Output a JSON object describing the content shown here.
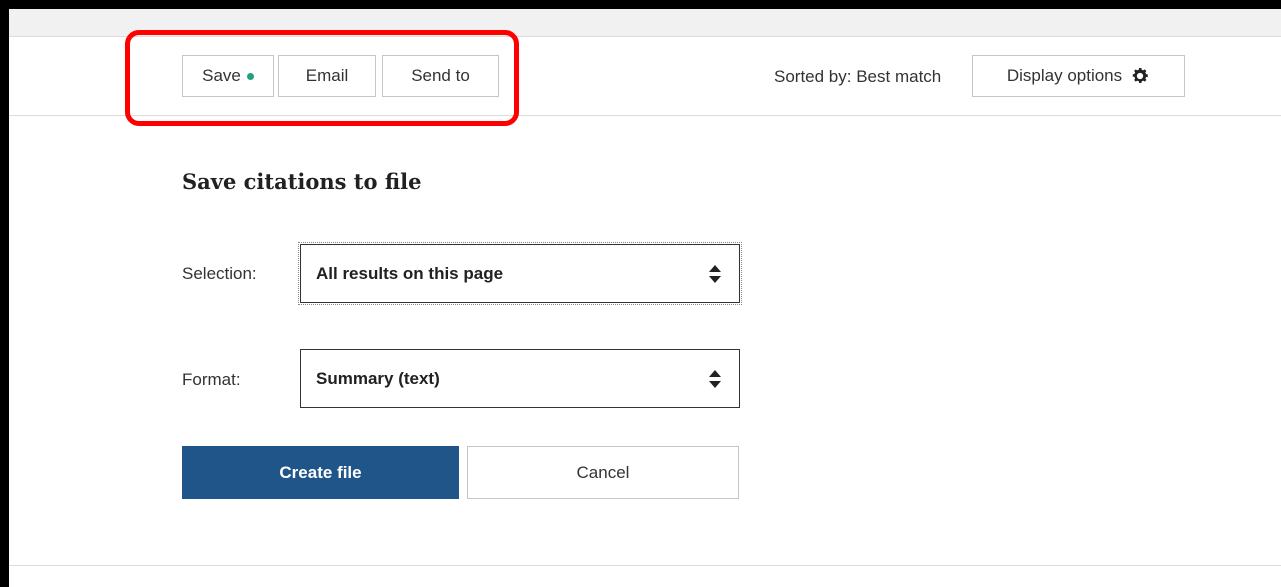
{
  "toolbar": {
    "save_label": "Save",
    "email_label": "Email",
    "send_to_label": "Send to",
    "sorted_by": "Sorted by: Best match",
    "display_options_label": "Display options"
  },
  "panel": {
    "title": "Save citations to file",
    "selection_label": "Selection:",
    "selection_value": "All results on this page",
    "format_label": "Format:",
    "format_value": "Summary (text)",
    "create_label": "Create file",
    "cancel_label": "Cancel"
  },
  "icons": {
    "save_indicator": "dot-indicator",
    "display_options": "gear-icon",
    "select_arrows": "up-down-arrows-icon"
  },
  "colors": {
    "primary": "#20558a",
    "highlight": "#ff0000",
    "indicator": "#20a080"
  }
}
